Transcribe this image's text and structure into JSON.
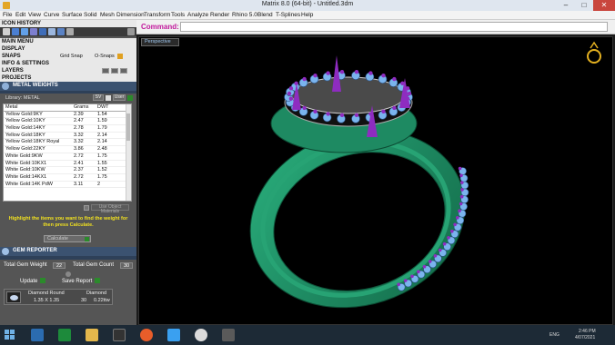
{
  "window": {
    "title": "Matrix 8.0 (64-bit) - Untitled.3dm"
  },
  "menu": [
    "File",
    "Edit",
    "View",
    "Curve",
    "Surface",
    "Solid",
    "Mesh",
    "Dimension",
    "Transform",
    "Tools",
    "Analyze",
    "Render",
    "Rhino 5.0",
    "Blend",
    "T-Splines",
    "Help"
  ],
  "panel": {
    "icon_history": "ICON HISTORY",
    "main_menu": "MAIN MENU",
    "display": "DISPLAY",
    "snaps": "SNAPS",
    "grid_snap": "Grid Snap",
    "o_snaps": "O-Snaps",
    "info_settings": "INFO & SETTINGS",
    "layers": "LAYERS",
    "projects": "PROJECTS",
    "metal_weights": "METAL WEIGHTS",
    "library_label": "Library: METAL",
    "sv": "SV",
    "user": "User"
  },
  "metal_table": {
    "headers": [
      "Metal",
      "Grams",
      "DWT"
    ],
    "rows": [
      [
        "Yellow Gold:9KY",
        "2.39",
        "1.54"
      ],
      [
        "Yellow Gold:10KY",
        "2.47",
        "1.59"
      ],
      [
        "Yellow Gold:14KY",
        "2.78",
        "1.79"
      ],
      [
        "Yellow Gold:18KY",
        "3.32",
        "2.14"
      ],
      [
        "Yellow Gold:18KY Royal",
        "3.32",
        "2.14"
      ],
      [
        "Yellow Gold:22KY",
        "3.86",
        "2.48"
      ],
      [
        "White Gold:9KW",
        "2.72",
        "1.75"
      ],
      [
        "White Gold:10KX1",
        "2.41",
        "1.55"
      ],
      [
        "White Gold:10KW",
        "2.37",
        "1.52"
      ],
      [
        "White Gold:14KX1",
        "2.72",
        "1.75"
      ],
      [
        "White Gold:14K PdW",
        "3.11",
        "2"
      ]
    ]
  },
  "use_object_materials": "Use Object Materials",
  "hint_text": "Highlight the items you want to find the weight for then press Calculate.",
  "calculate_label": "Calculate",
  "gem_reporter": {
    "title": "GEM REPORTER",
    "total_gem_weight_label": "Total Gem Weight",
    "total_gem_weight": "22",
    "total_gem_count_label": "Total Gem Count",
    "total_gem_count": "30",
    "update_label": "Update",
    "save_report_label": "Save Report",
    "gem_name": "Diamond Round",
    "gem_size": "1.35 X 1.35",
    "gem_type": "Diamond",
    "gem_count": "30",
    "gem_weight": "0.22ttw"
  },
  "command": {
    "label": "Command:",
    "value": ""
  },
  "viewport": {
    "label": "Perspective"
  },
  "taskbar": {
    "lang": "ENG",
    "time": "2:46 PM",
    "date": "4/07/2021"
  },
  "colors": {
    "band": "#1e8a62",
    "prong": "#8e2cc0",
    "stone": "#7ab4ee",
    "head": "#c0c0c0"
  }
}
